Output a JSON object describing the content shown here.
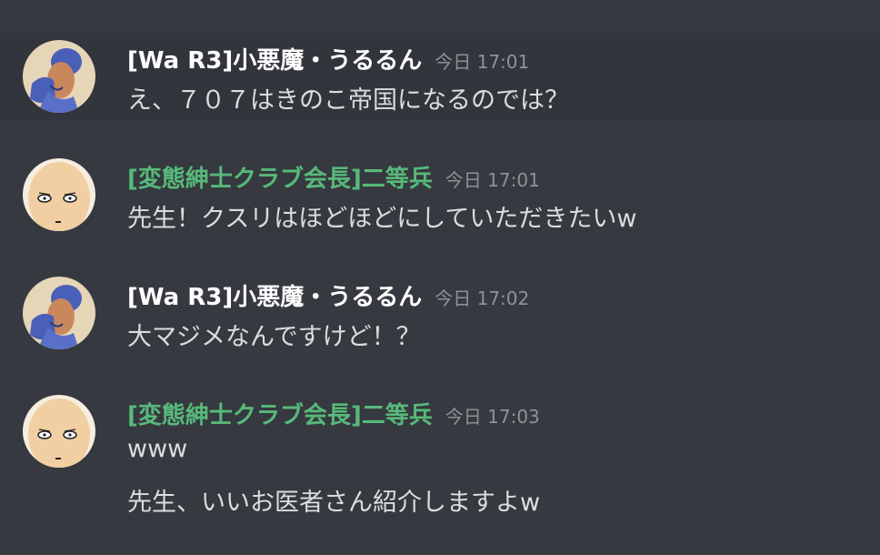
{
  "messages": [
    {
      "author": "[Wa R3]小悪魔・うるるん",
      "author_color": "#ffffff",
      "timestamp": "今日 17:01",
      "avatar_icon": "blue-hair-figure-avatar",
      "lines": [
        "え、７０７はきのこ帝国になるのでは？"
      ]
    },
    {
      "author": "[変態紳士クラブ会長]二等兵",
      "author_color": "#57b97a",
      "timestamp": "今日 17:01",
      "avatar_icon": "bald-face-avatar",
      "lines": [
        "先生！クスリはほどほどにしていただきたいw"
      ]
    },
    {
      "author": "[Wa R3]小悪魔・うるるん",
      "author_color": "#ffffff",
      "timestamp": "今日 17:02",
      "avatar_icon": "blue-hair-figure-avatar",
      "lines": [
        "大マジメなんですけど！？"
      ]
    },
    {
      "author": "[変態紳士クラブ会長]二等兵",
      "author_color": "#57b97a",
      "timestamp": "今日 17:03",
      "avatar_icon": "bald-face-avatar",
      "lines": [
        "www",
        "先生、いいお医者さん紹介しますよw"
      ]
    }
  ]
}
